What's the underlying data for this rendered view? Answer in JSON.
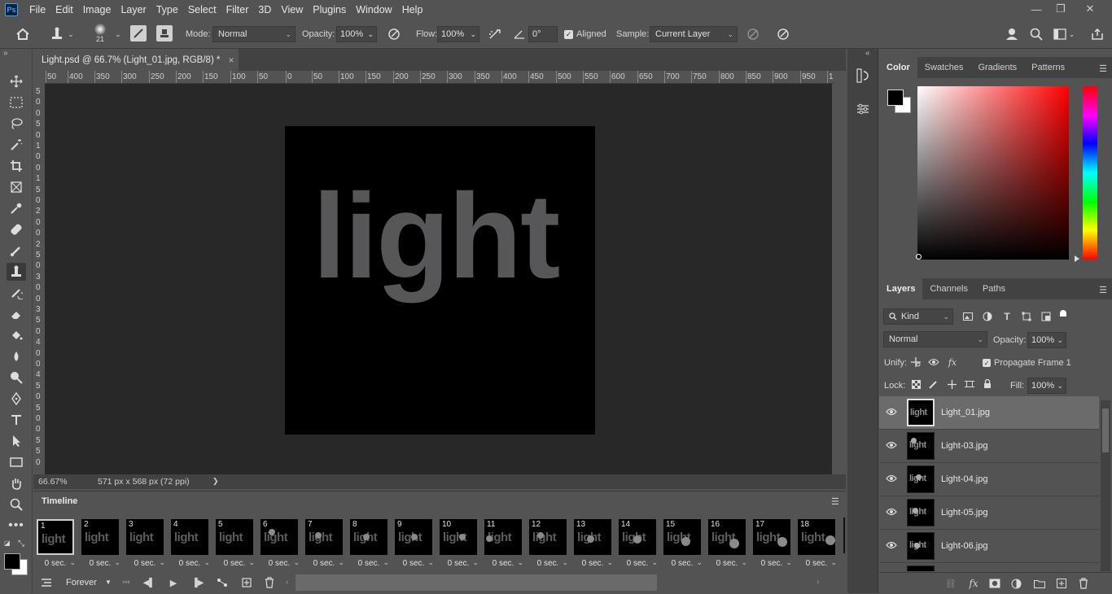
{
  "app": {
    "logo": "Ps",
    "menu": [
      "File",
      "Edit",
      "Image",
      "Layer",
      "Type",
      "Select",
      "Filter",
      "3D",
      "View",
      "Plugins",
      "Window",
      "Help"
    ],
    "window_controls": [
      "—",
      "❐",
      "✕"
    ]
  },
  "options": {
    "brush_size": "21",
    "mode_label": "Mode:",
    "mode_value": "Normal",
    "opacity_label": "Opacity:",
    "opacity_value": "100%",
    "flow_label": "Flow:",
    "flow_value": "100%",
    "angle_value": "0°",
    "aligned_label": "Aligned",
    "aligned_checked": true,
    "sample_label": "Sample:",
    "sample_value": "Current Layer"
  },
  "document": {
    "tab_title": "Light.psd @ 66.7% (Light_01.jpg, RGB/8) *",
    "tab_close": "×",
    "canvas_text": "light",
    "ruler_h": [
      "50",
      "400",
      "350",
      "300",
      "250",
      "200",
      "150",
      "100",
      "50",
      "0",
      "50",
      "100",
      "150",
      "200",
      "250",
      "300",
      "350",
      "400",
      "450",
      "500",
      "550",
      "600",
      "650",
      "700",
      "750",
      "800",
      "850",
      "900",
      "950",
      "1"
    ],
    "ruler_v": [
      "5",
      "0",
      "0",
      "5",
      "0",
      "1",
      "0",
      "0",
      "1",
      "5",
      "0",
      "2",
      "0",
      "0",
      "2",
      "5",
      "0",
      "3",
      "0",
      "0",
      "3",
      "5",
      "0",
      "4",
      "0",
      "0",
      "4",
      "5",
      "0",
      "5",
      "0",
      "0",
      "5",
      "5",
      "0"
    ],
    "zoom": "66.67%",
    "dimensions": "571 px x 568 px (72 ppi)",
    "status_arrow": "❯"
  },
  "timeline": {
    "title": "Timeline",
    "loop": "Forever",
    "frames": [
      {
        "num": "1",
        "delay": "0 sec."
      },
      {
        "num": "2",
        "delay": "0 sec."
      },
      {
        "num": "3",
        "delay": "0 sec."
      },
      {
        "num": "4",
        "delay": "0 sec."
      },
      {
        "num": "5",
        "delay": "0 sec."
      },
      {
        "num": "6",
        "delay": "0 sec."
      },
      {
        "num": "7",
        "delay": "0 sec."
      },
      {
        "num": "8",
        "delay": "0 sec."
      },
      {
        "num": "9",
        "delay": "0 sec."
      },
      {
        "num": "10",
        "delay": "0 sec."
      },
      {
        "num": "11",
        "delay": "0 sec."
      },
      {
        "num": "12",
        "delay": "0 sec."
      },
      {
        "num": "13",
        "delay": "0 sec."
      },
      {
        "num": "14",
        "delay": "0 sec."
      },
      {
        "num": "15",
        "delay": "0 sec."
      },
      {
        "num": "16",
        "delay": "0 sec."
      },
      {
        "num": "17",
        "delay": "0 sec."
      },
      {
        "num": "18",
        "delay": "0 sec."
      }
    ],
    "frame_text": "light"
  },
  "color_panel": {
    "tabs": [
      "Color",
      "Swatches",
      "Gradients",
      "Patterns"
    ],
    "foreground": "#000000",
    "background": "#ffffff",
    "hue_color": "#ff0000"
  },
  "layers_panel": {
    "tabs": [
      "Layers",
      "Channels",
      "Paths"
    ],
    "filter_kind": "Kind",
    "blend_mode": "Normal",
    "opacity_label": "Opacity:",
    "opacity_value": "100%",
    "unify_label": "Unify:",
    "propagate_label": "Propagate Frame 1",
    "lock_label": "Lock:",
    "fill_label": "Fill:",
    "fill_value": "100%",
    "layers": [
      {
        "name": "Light_01.jpg",
        "selected": true
      },
      {
        "name": "Light-03.jpg",
        "selected": false
      },
      {
        "name": "Light-04.jpg",
        "selected": false
      },
      {
        "name": "Light-05.jpg",
        "selected": false
      },
      {
        "name": "Light-06.jpg",
        "selected": false
      }
    ],
    "thumb_text": "light"
  }
}
